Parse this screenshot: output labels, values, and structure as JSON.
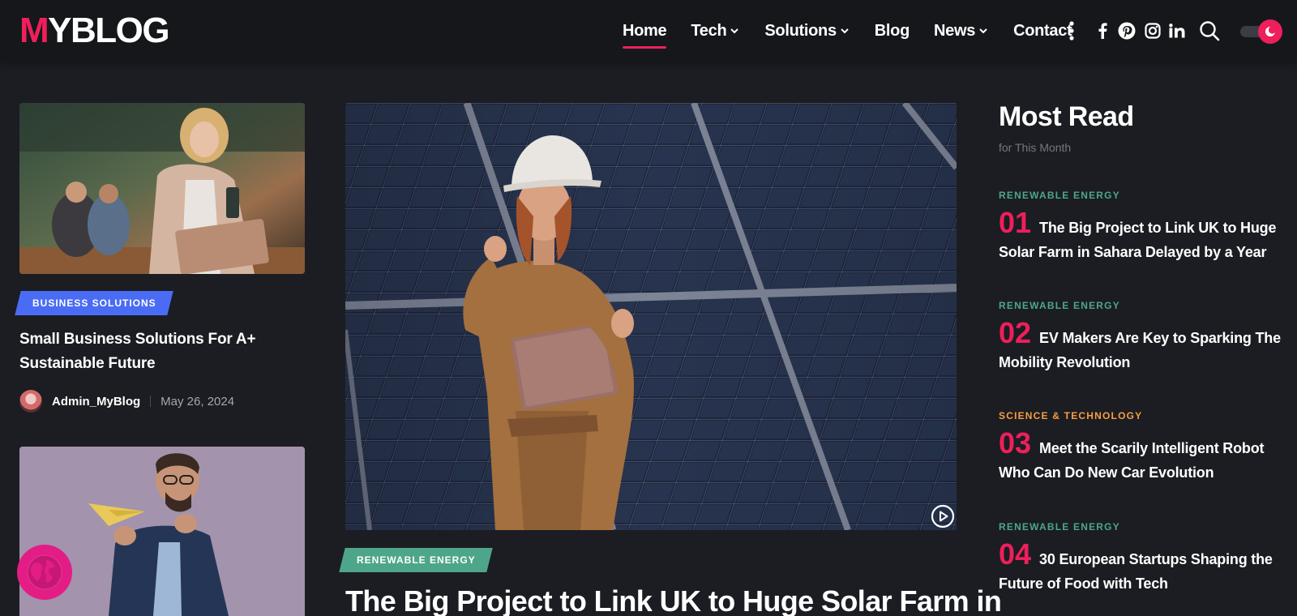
{
  "header": {
    "logo_first": "M",
    "logo_rest": "YBLOG",
    "nav": [
      {
        "label": "Home",
        "active": true,
        "dropdown": false
      },
      {
        "label": "Tech",
        "active": false,
        "dropdown": true
      },
      {
        "label": "Solutions",
        "active": false,
        "dropdown": true
      },
      {
        "label": "Blog",
        "active": false,
        "dropdown": false
      },
      {
        "label": "News",
        "active": false,
        "dropdown": true
      },
      {
        "label": "Contact",
        "active": false,
        "dropdown": false
      }
    ],
    "icons": [
      "more-vertical-icon",
      "facebook-icon",
      "pinterest-icon",
      "instagram-icon",
      "linkedin-icon",
      "search-icon",
      "dark-mode-toggle"
    ]
  },
  "left": {
    "post1": {
      "category": "BUSINESS SOLUTIONS",
      "title": "Small Business Solutions For A+ Sustainable Future",
      "author": "Admin_MyBlog",
      "date": "May 26, 2024"
    }
  },
  "hero": {
    "category": "RENEWABLE ENERGY",
    "title": "The Big Project to Link UK to Huge Solar Farm in"
  },
  "sidebar": {
    "title": "Most Read",
    "subtitle": "for This Month",
    "items": [
      {
        "num": "01",
        "category": "RENEWABLE ENERGY",
        "title": "The Big Project to Link UK to Huge Solar Farm in Sahara Delayed by a Year"
      },
      {
        "num": "02",
        "category": "RENEWABLE ENERGY",
        "title": "EV Makers Are Key to Sparking The Mobility Revolution"
      },
      {
        "num": "03",
        "category": "SCIENCE & TECHNOLOGY",
        "title": "Meet the Scarily Intelligent Robot Who Can Do New Car Evolution"
      },
      {
        "num": "04",
        "category": "RENEWABLE ENERGY",
        "title": "30 European Startups Shaping the Future of Food with Tech"
      }
    ]
  },
  "colors": {
    "accent": "#ee1f5b",
    "renewable": "#4ea68a",
    "science": "#f59e42",
    "business": "#4a6cf5",
    "background": "#1b1d22"
  }
}
